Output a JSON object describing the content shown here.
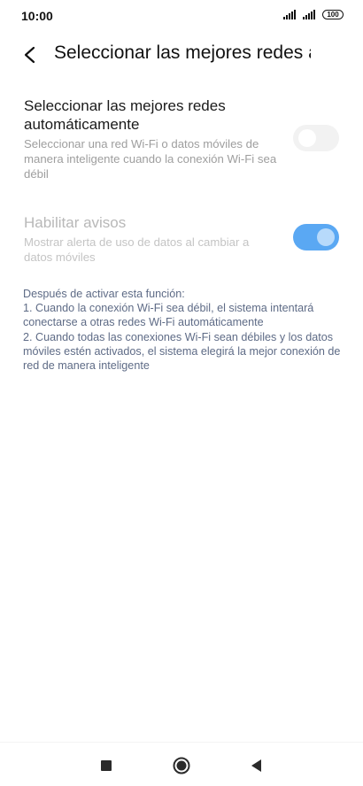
{
  "status_bar": {
    "time": "10:00",
    "battery": "100",
    "icons": [
      "signal-icon",
      "signal-icon",
      "battery-icon"
    ]
  },
  "header": {
    "back_icon": "back-arrow-icon",
    "title": "Seleccionar las mejores redes a"
  },
  "settings": [
    {
      "title": "Seleccionar las mejores redes automáticamente",
      "description": "Seleccionar una red Wi-Fi o datos móviles de manera inteligente cuando la conexión Wi-Fi sea débil",
      "enabled": true,
      "toggle_on": false
    },
    {
      "title": "Habilitar avisos",
      "description": "Mostrar alerta de uso de datos al cambiar a datos móviles",
      "enabled": false,
      "toggle_on": true
    }
  ],
  "note": {
    "heading": "Después de activar esta función:",
    "item_1": "1. Cuando la conexión Wi-Fi sea débil, el sistema intentará conectarse a otras redes Wi-Fi automáticamente",
    "item_2": "2. Cuando todas las conexiones Wi-Fi sean débiles y los datos móviles estén activados, el sistema elegirá la mejor conexión de red de manera inteligente"
  },
  "nav_bar": {
    "icons": [
      "recents-square-icon",
      "home-circle-icon",
      "back-triangle-icon"
    ]
  },
  "colors": {
    "accent": "#5aa8f3",
    "note_text": "#5e6b86",
    "secondary_text": "#9e9e9e"
  }
}
